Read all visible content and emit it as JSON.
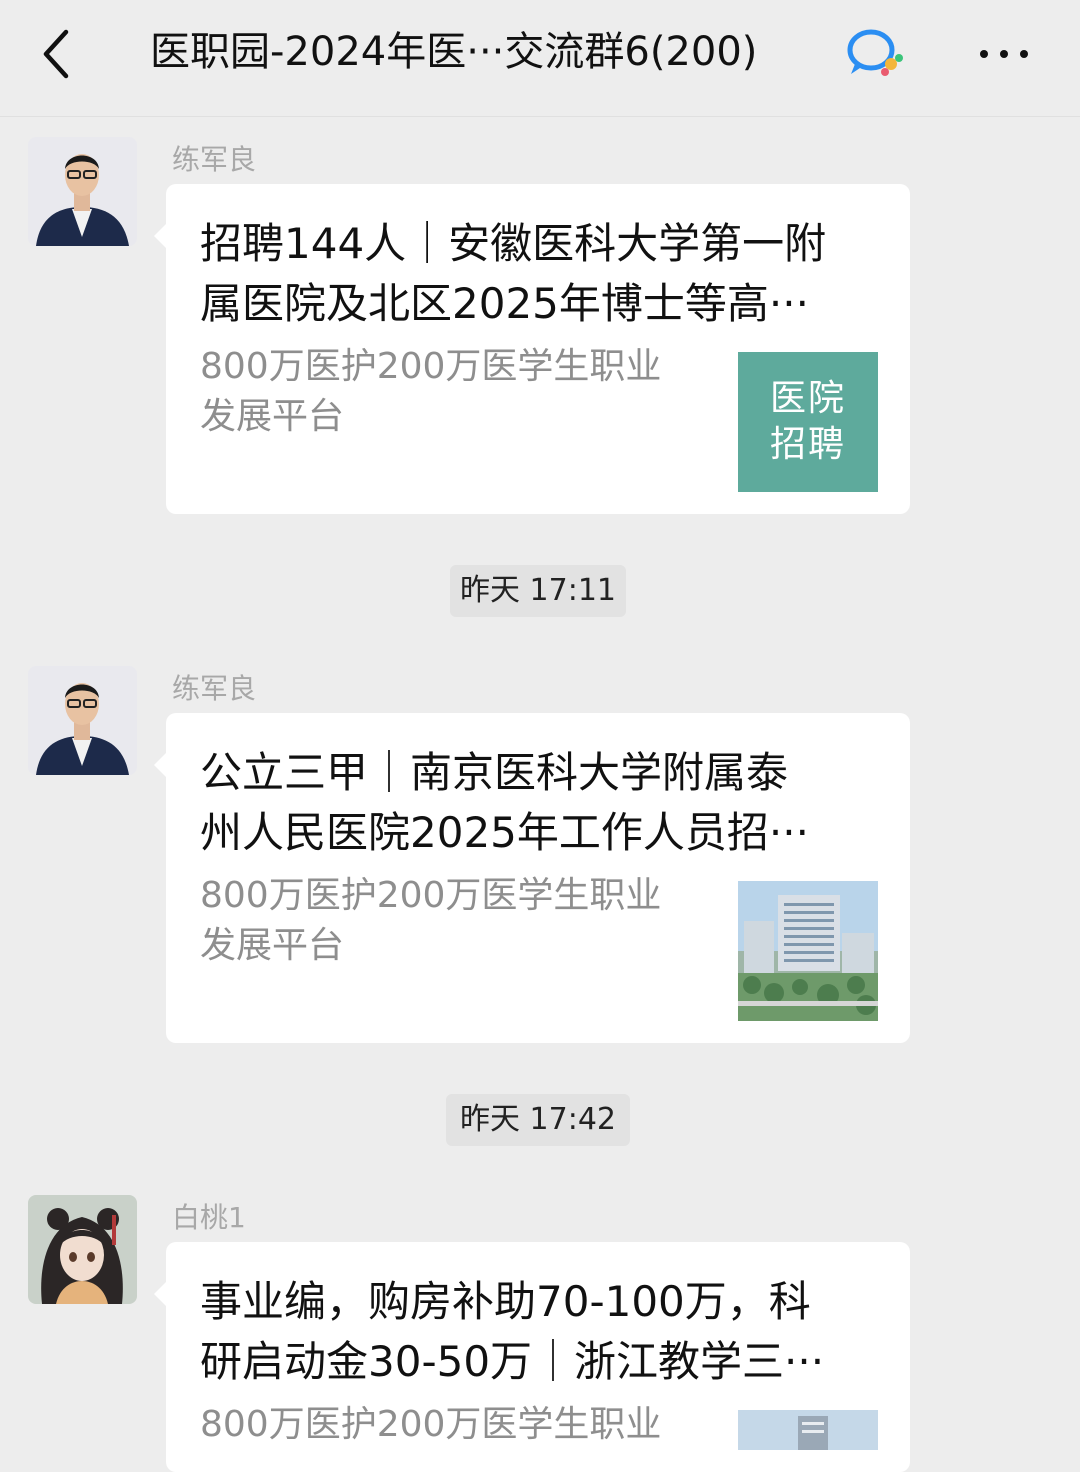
{
  "header": {
    "title": "医职园-2024年医···交流群6(200)",
    "back_icon": "chevron-left-icon",
    "badge_icon": "chat-bubble-icon",
    "more_icon": "ellipsis-icon"
  },
  "messages": [
    {
      "sender": "练军良",
      "title_line1": "招聘144人｜安徽医科大学第一附",
      "title_line2": "属医院及北区2025年博士等高···",
      "desc_line1": "800万医护200万医学生职业",
      "desc_line2": "发展平台",
      "thumb_line1": "医院",
      "thumb_line2": "招聘"
    },
    {
      "sender": "练军良",
      "title_line1": "公立三甲｜南京医科大学附属泰",
      "title_line2": "州人民医院2025年工作人员招···",
      "desc_line1": "800万医护200万医学生职业",
      "desc_line2": "发展平台"
    },
    {
      "sender": "白桃1",
      "title_line1": "事业编，购房补助70-100万，科",
      "title_line2": "研启动金30-50万｜浙江教学三···",
      "desc_line1": "800万医护200万医学生职业"
    }
  ],
  "times": [
    "昨天 17:11",
    "昨天 17:42"
  ],
  "colors": {
    "background": "#ededed",
    "card": "#ffffff",
    "thumb_green": "#5eaa9c",
    "meta_gray": "#8e8e8e"
  }
}
